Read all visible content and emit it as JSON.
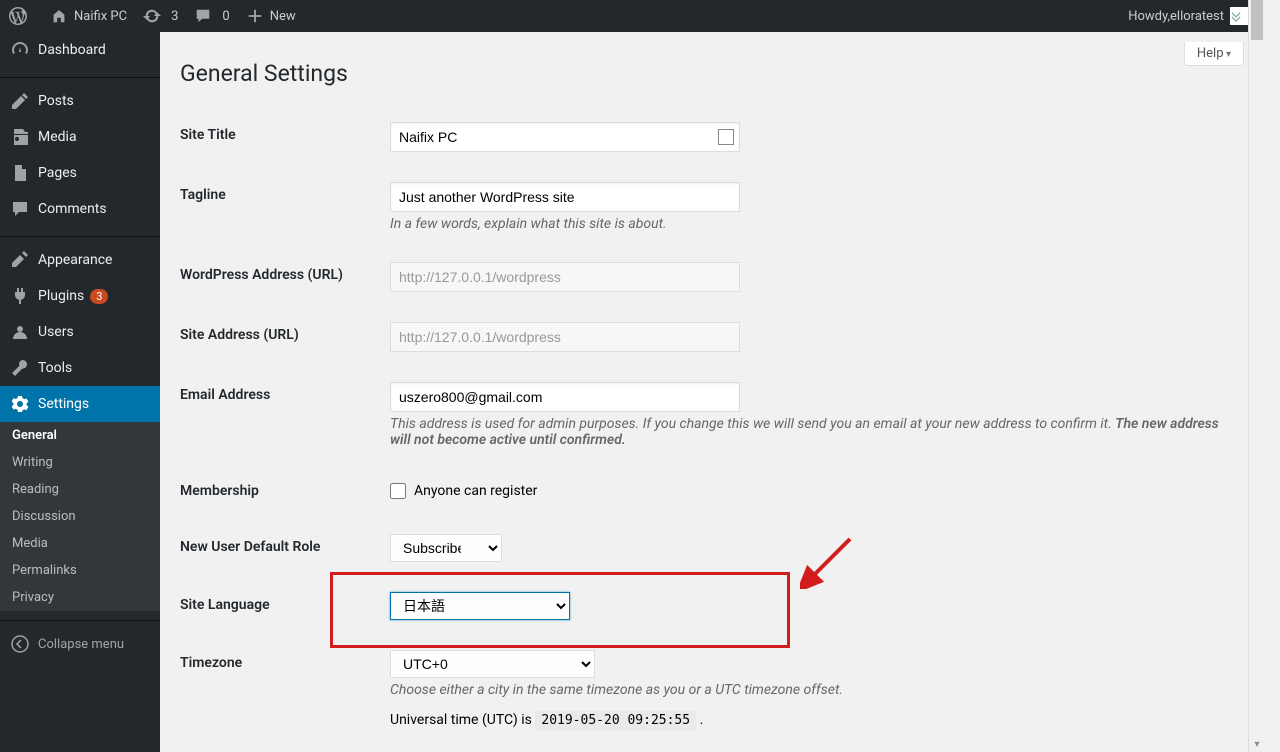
{
  "adminbar": {
    "site_title": "Naifix PC",
    "revisions_count": "3",
    "comments_count": "0",
    "new_label": "New",
    "howdy_prefix": "Howdy, ",
    "username": "elloratest"
  },
  "sidebar": {
    "items": [
      {
        "id": "dashboard",
        "label": "Dashboard"
      },
      {
        "id": "posts",
        "label": "Posts"
      },
      {
        "id": "media",
        "label": "Media"
      },
      {
        "id": "pages",
        "label": "Pages"
      },
      {
        "id": "comments",
        "label": "Comments"
      },
      {
        "id": "appearance",
        "label": "Appearance"
      },
      {
        "id": "plugins",
        "label": "Plugins",
        "badge": "3"
      },
      {
        "id": "users",
        "label": "Users"
      },
      {
        "id": "tools",
        "label": "Tools"
      },
      {
        "id": "settings",
        "label": "Settings"
      }
    ],
    "submenu": [
      {
        "id": "general",
        "label": "General",
        "current": true
      },
      {
        "id": "writing",
        "label": "Writing"
      },
      {
        "id": "reading",
        "label": "Reading"
      },
      {
        "id": "discussion",
        "label": "Discussion"
      },
      {
        "id": "media",
        "label": "Media"
      },
      {
        "id": "permalinks",
        "label": "Permalinks"
      },
      {
        "id": "privacy",
        "label": "Privacy"
      }
    ],
    "collapse_label": "Collapse menu"
  },
  "content": {
    "help_label": "Help",
    "page_title": "General Settings",
    "fields": {
      "site_title": {
        "label": "Site Title",
        "value": "Naifix PC"
      },
      "tagline": {
        "label": "Tagline",
        "value": "Just another WordPress site",
        "desc": "In a few words, explain what this site is about."
      },
      "wp_address": {
        "label": "WordPress Address (URL)",
        "value": "http://127.0.0.1/wordpress"
      },
      "site_address": {
        "label": "Site Address (URL)",
        "value": "http://127.0.0.1/wordpress"
      },
      "email": {
        "label": "Email Address",
        "value": "uszero800@gmail.com",
        "desc_pre": "This address is used for admin purposes. If you change this we will send you an email at your new address to confirm it. ",
        "desc_bold": "The new address will not become active until confirmed."
      },
      "membership": {
        "label": "Membership",
        "checkbox_label": "Anyone can register"
      },
      "default_role": {
        "label": "New User Default Role",
        "value": "Subscriber"
      },
      "language": {
        "label": "Site Language",
        "value": "日本語"
      },
      "timezone": {
        "label": "Timezone",
        "value": "UTC+0",
        "desc": "Choose either a city in the same timezone as you or a UTC timezone offset.",
        "utc_label": "Universal time (UTC) is ",
        "utc_value": "2019-05-20 09:25:55",
        "utc_suffix": " ."
      }
    }
  }
}
